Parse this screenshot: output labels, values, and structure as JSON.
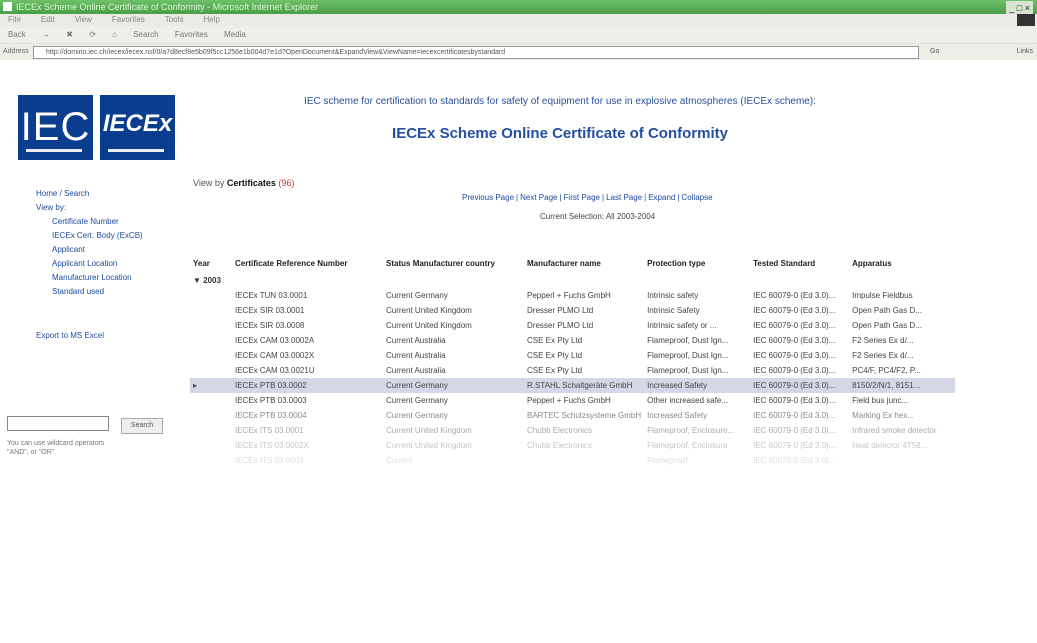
{
  "window": {
    "title": "IECEx Scheme Online Certificate of Conformity - Microsoft Internet Explorer",
    "controls": "_ □ ×"
  },
  "menu": [
    "File",
    "Edit",
    "View",
    "Favorites",
    "Tools",
    "Help"
  ],
  "toolbar": {
    "back": "Back",
    "forward": "→",
    "search": "Search",
    "favorites": "Favorites",
    "media": "Media"
  },
  "address": {
    "label": "Address",
    "url": "http://domino.iec.ch/iecex/iecex.nsf/0/a7d8ecf8e5b09f5cc1256e1b004d7e1d?OpenDocument&ExpandView&ViewName=iecexcertificatesbystandard",
    "go": "Go",
    "links": "Links"
  },
  "logos": {
    "iec": "IEC",
    "iecex": "IECEx"
  },
  "header": {
    "line1": "IEC scheme for certification to standards for safety of equipment for use in explosive atmospheres (IECEx scheme):",
    "title": "IECEx Scheme Online Certificate of Conformity"
  },
  "sidebar": {
    "items": [
      {
        "label": "Home / Search",
        "indent": false
      },
      {
        "label": "View by:",
        "indent": false
      },
      {
        "label": "Certificate Number",
        "indent": true
      },
      {
        "label": "IECEx Cert. Body (ExCB)",
        "indent": true
      },
      {
        "label": "Applicant",
        "indent": true
      },
      {
        "label": "Applicant Location",
        "indent": true
      },
      {
        "label": "Manufacturer Location",
        "indent": true
      },
      {
        "label": "Standard used",
        "indent": true
      }
    ],
    "export": "Export to MS Excel"
  },
  "search": {
    "value": "",
    "button": "Search",
    "hint_line1": "You can use wildcard operators",
    "hint_line2": "\"AND\", or \"OR\""
  },
  "main": {
    "viewby_label": "View by",
    "viewby_value": "Certificates",
    "viewby_count": "(96)",
    "pager": [
      "Previous Page",
      "Next Page",
      "First Page",
      "Last Page",
      "Expand",
      "Collapse"
    ],
    "current_selection": "Current Selection: All 2003-2004"
  },
  "table": {
    "headers": [
      "Year",
      "Certificate Reference Number",
      "Status",
      "Manufacturer country",
      "Manufacturer name",
      "Protection type",
      "Tested Standard",
      "Apparatus"
    ],
    "year_group": "2003",
    "rows": [
      [
        "",
        "IECEx TUN 03.0001",
        "Current",
        "Germany",
        "Pepperl + Fuchs GmbH",
        "Intrinsic safety",
        "IEC 60079-0 (Ed 3.0)...",
        "Impulse Fieldbus"
      ],
      [
        "",
        "IECEx SIR 03.0001",
        "Current",
        "United Kingdom",
        "Dresser PLMO Ltd",
        "Intrinsic Safety",
        "IEC 60079-0 (Ed 3.0)...",
        "Open Path Gas D..."
      ],
      [
        "",
        "IECEx SIR 03.0008",
        "Current",
        "United Kingdom",
        "Dresser PLMO Ltd",
        "Intrinsic safety or ...",
        "IEC 60079-0 (Ed 3.0)...",
        "Open Path Gas D..."
      ],
      [
        "",
        "IECEx CAM 03.0002A",
        "Current",
        "Australia",
        "CSE Ex Pty Ltd",
        "Flameproof, Dust Ign...",
        "IEC 60079-0 (Ed 3.0)...",
        "F2 Series Ex d/..."
      ],
      [
        "",
        "IECEx CAM 03.0002X",
        "Current",
        "Australia",
        "CSE Ex Pty Ltd",
        "Flameproof, Dust Ign...",
        "IEC 60079-0 (Ed 3.0)...",
        "F2 Series Ex d/..."
      ],
      [
        "",
        "IECEx CAM 03.0021U",
        "Current",
        "Australia",
        "CSE Ex Pty Ltd",
        "Flameproof, Dust Ign...",
        "IEC 60079-0 (Ed 3.0)...",
        "PC4/F, PC4/F2, P..."
      ],
      [
        "▸",
        "IECEx PTB 03.0002",
        "Current",
        "Germany",
        "R.STAHL Schaltgeräte GmbH",
        "Increased Safety",
        "IEC 60079-0 (Ed 3.0)...",
        "8150/2/N/1, 8151..."
      ],
      [
        "",
        "IECEx PTB 03.0003",
        "Current",
        "Germany",
        "Pepperl + Fuchs GmbH",
        "Other increased safe...",
        "IEC 60079-0 (Ed 3.0)...",
        "Field bus junc..."
      ],
      [
        "",
        "IECEx PTB 03.0004",
        "Current",
        "Germany",
        "BARTEC Schutzsysteme GmbH",
        "Increased Safety",
        "IEC 60079-0 (Ed 3.0)...",
        "Marking Ex hex..."
      ],
      [
        "",
        "IECEx ITS 03.0001",
        "Current",
        "United Kingdom",
        "Chubb Electronics",
        "Flameproof, Enclosure...",
        "IEC 60079-0 (Ed 3.0)...",
        "Infrared smoke detector"
      ],
      [
        "",
        "IECEx ITS 03.0002X",
        "Current",
        "United Kingdom",
        "Chubb Electronics",
        "Flameproof, Enclosure",
        "IEC 60079-0 (Ed 3.0)...",
        "Heat detector 4T58..."
      ],
      [
        "",
        "IECEx ITS 03.0003",
        "Current",
        "",
        "",
        "Flameproof",
        "IEC 60079-0 (Ed 3.0)...",
        ""
      ]
    ]
  }
}
